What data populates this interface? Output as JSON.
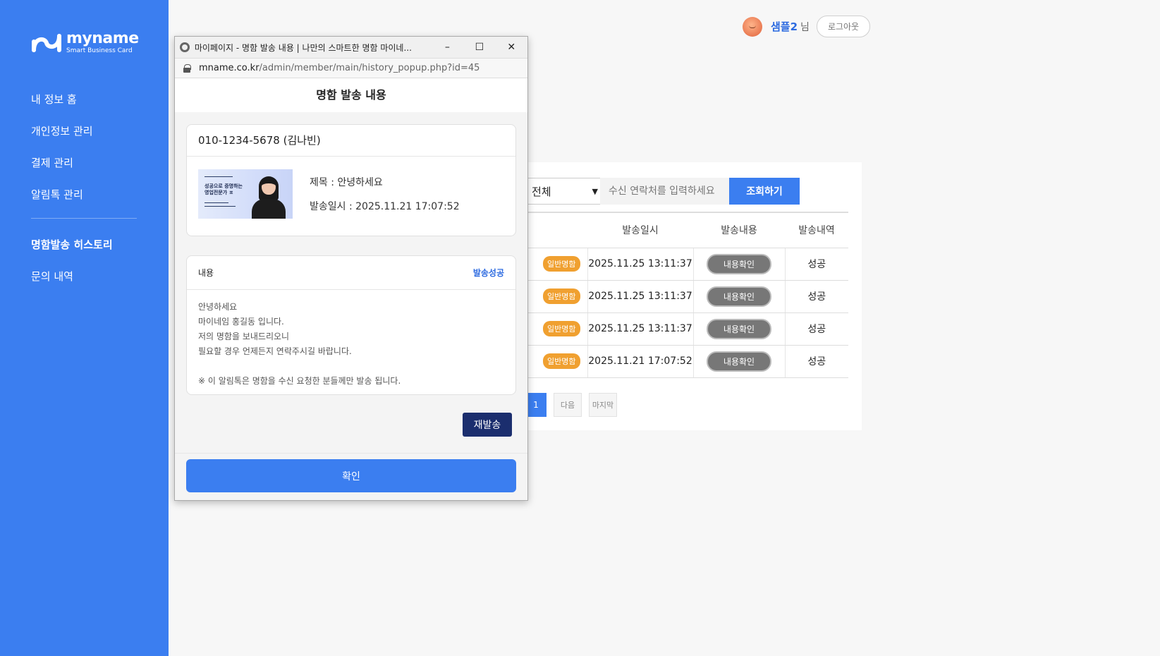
{
  "sidebar": {
    "logo_name": "myname",
    "logo_sub": "Smart Business Card",
    "items": [
      {
        "label": "내 정보 홈"
      },
      {
        "label": "개인정보 관리"
      },
      {
        "label": "결제 관리"
      },
      {
        "label": "알림톡 관리"
      },
      {
        "label": "명함발송 히스토리"
      },
      {
        "label": "문의 내역"
      }
    ],
    "active": "명함발송 히스토리"
  },
  "header": {
    "user_name": "샘플2",
    "user_suffix": "님",
    "logout_label": "로그아웃"
  },
  "filters": {
    "select_value": "전체",
    "search_placeholder": "수신 연락처를 입력하세요",
    "search_button": "조회하기"
  },
  "table": {
    "headers": [
      "발송일시",
      "발송내용",
      "발송내역"
    ],
    "rows": [
      {
        "type": "일반명함",
        "date": "2025.11.25 13:11:37",
        "content_button": "내용확인",
        "result": "성공"
      },
      {
        "type": "일반명함",
        "date": "2025.11.25 13:11:37",
        "content_button": "내용확인",
        "result": "성공"
      },
      {
        "type": "일반명함",
        "date": "2025.11.25 13:11:37",
        "content_button": "내용확인",
        "result": "성공"
      },
      {
        "type": "일반명함",
        "date": "2025.11.21 17:07:52",
        "content_button": "내용확인",
        "result": "성공"
      }
    ]
  },
  "pagination": {
    "current": "1",
    "next": "다음",
    "last": "마지막"
  },
  "popup": {
    "window_title": "마이페이지 - 명함 발송 내용 | 나만의 스마트한 명함 마이네...",
    "url_domain": "mname.co.kr",
    "url_path": "/admin/member/main/history_popup.php?id=45",
    "heading": "명함 발송 내용",
    "recipient": "010-1234-5678 (김나빈)",
    "thumb_lines": [
      "성공으로 증명하는",
      "영업전문가 ㅍ"
    ],
    "subject": "제목 : 안녕하세요",
    "sent_at": "발송일시 : 2025.11.21 17:07:52",
    "message_label": "내용",
    "message_status": "발송성공",
    "message_lines": [
      "안녕하세요",
      "마이네임 홍길동 입니다.",
      "저의 명함을 보내드리오니",
      "필요할 경우 언제든지 연락주시길 바랍니다.",
      ""
    ],
    "message_note": "※ 이 알림톡은 명함을 수신 요청한 분들께만 발송 됩니다.",
    "resend_button": "재발송",
    "confirm_button": "확인"
  },
  "colors": {
    "sidebar_bg": "#3b7ef0",
    "primary": "#3b7ef0",
    "badge": "#f0a030",
    "resend": "#1b2e6e"
  }
}
